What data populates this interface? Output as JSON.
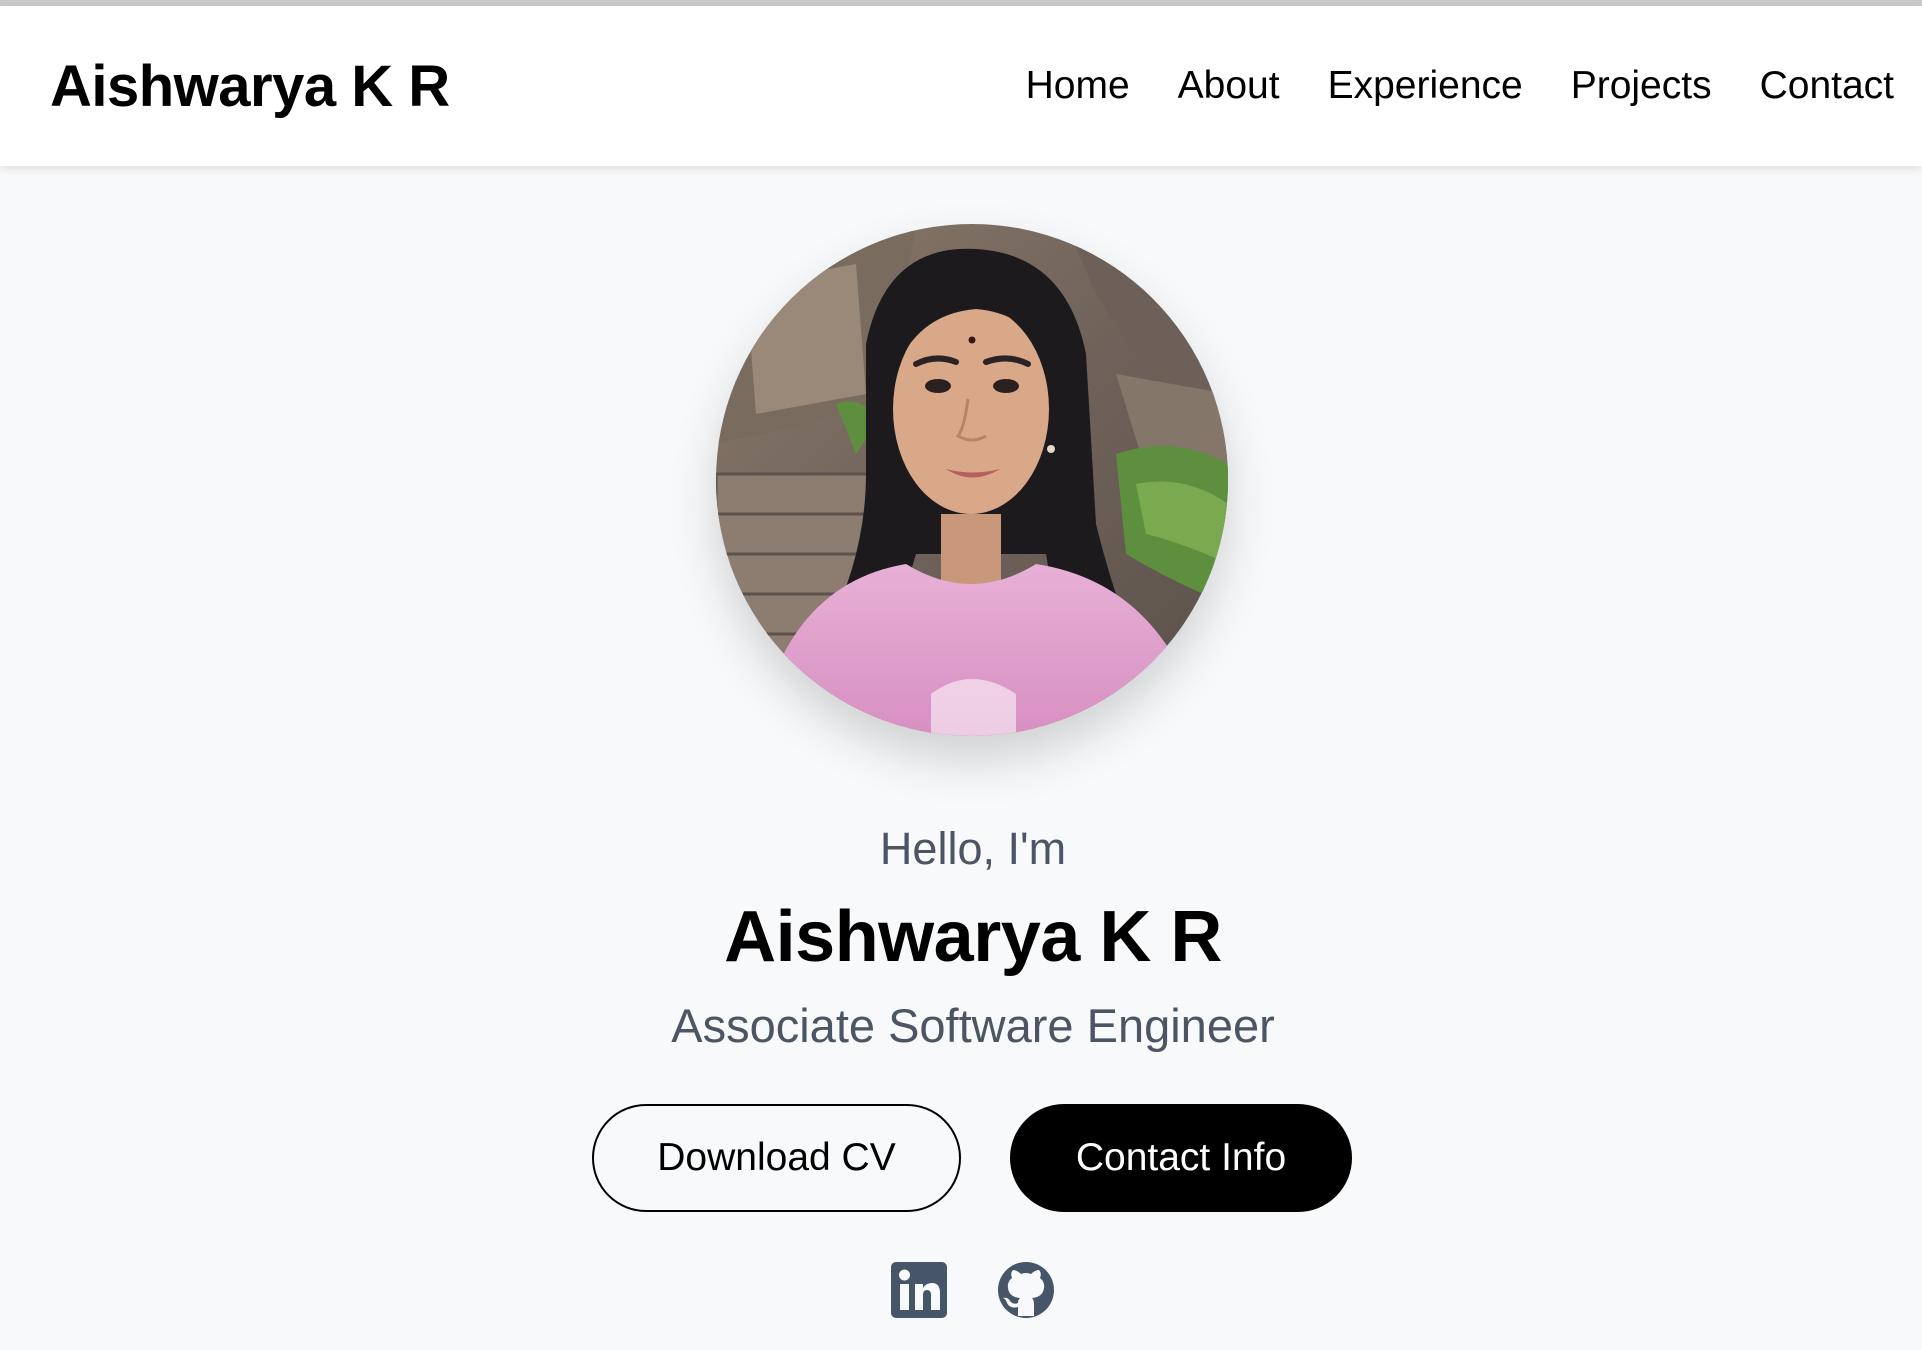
{
  "header": {
    "brand": "Aishwarya K R",
    "nav": [
      {
        "label": "Home"
      },
      {
        "label": "About"
      },
      {
        "label": "Experience"
      },
      {
        "label": "Projects"
      },
      {
        "label": "Contact"
      }
    ]
  },
  "hero": {
    "greeting": "Hello, I'm",
    "name": "Aishwarya K R",
    "role": "Associate Software Engineer",
    "buttons": {
      "download_cv": "Download CV",
      "contact_info": "Contact Info"
    },
    "socials": [
      {
        "icon": "linkedin-icon"
      },
      {
        "icon": "github-icon"
      }
    ]
  },
  "colors": {
    "background": "#f8f9fa",
    "header_bg": "#ffffff",
    "primary_text": "#000000",
    "secondary_text": "#4b5563",
    "icon_color": "#475569"
  }
}
